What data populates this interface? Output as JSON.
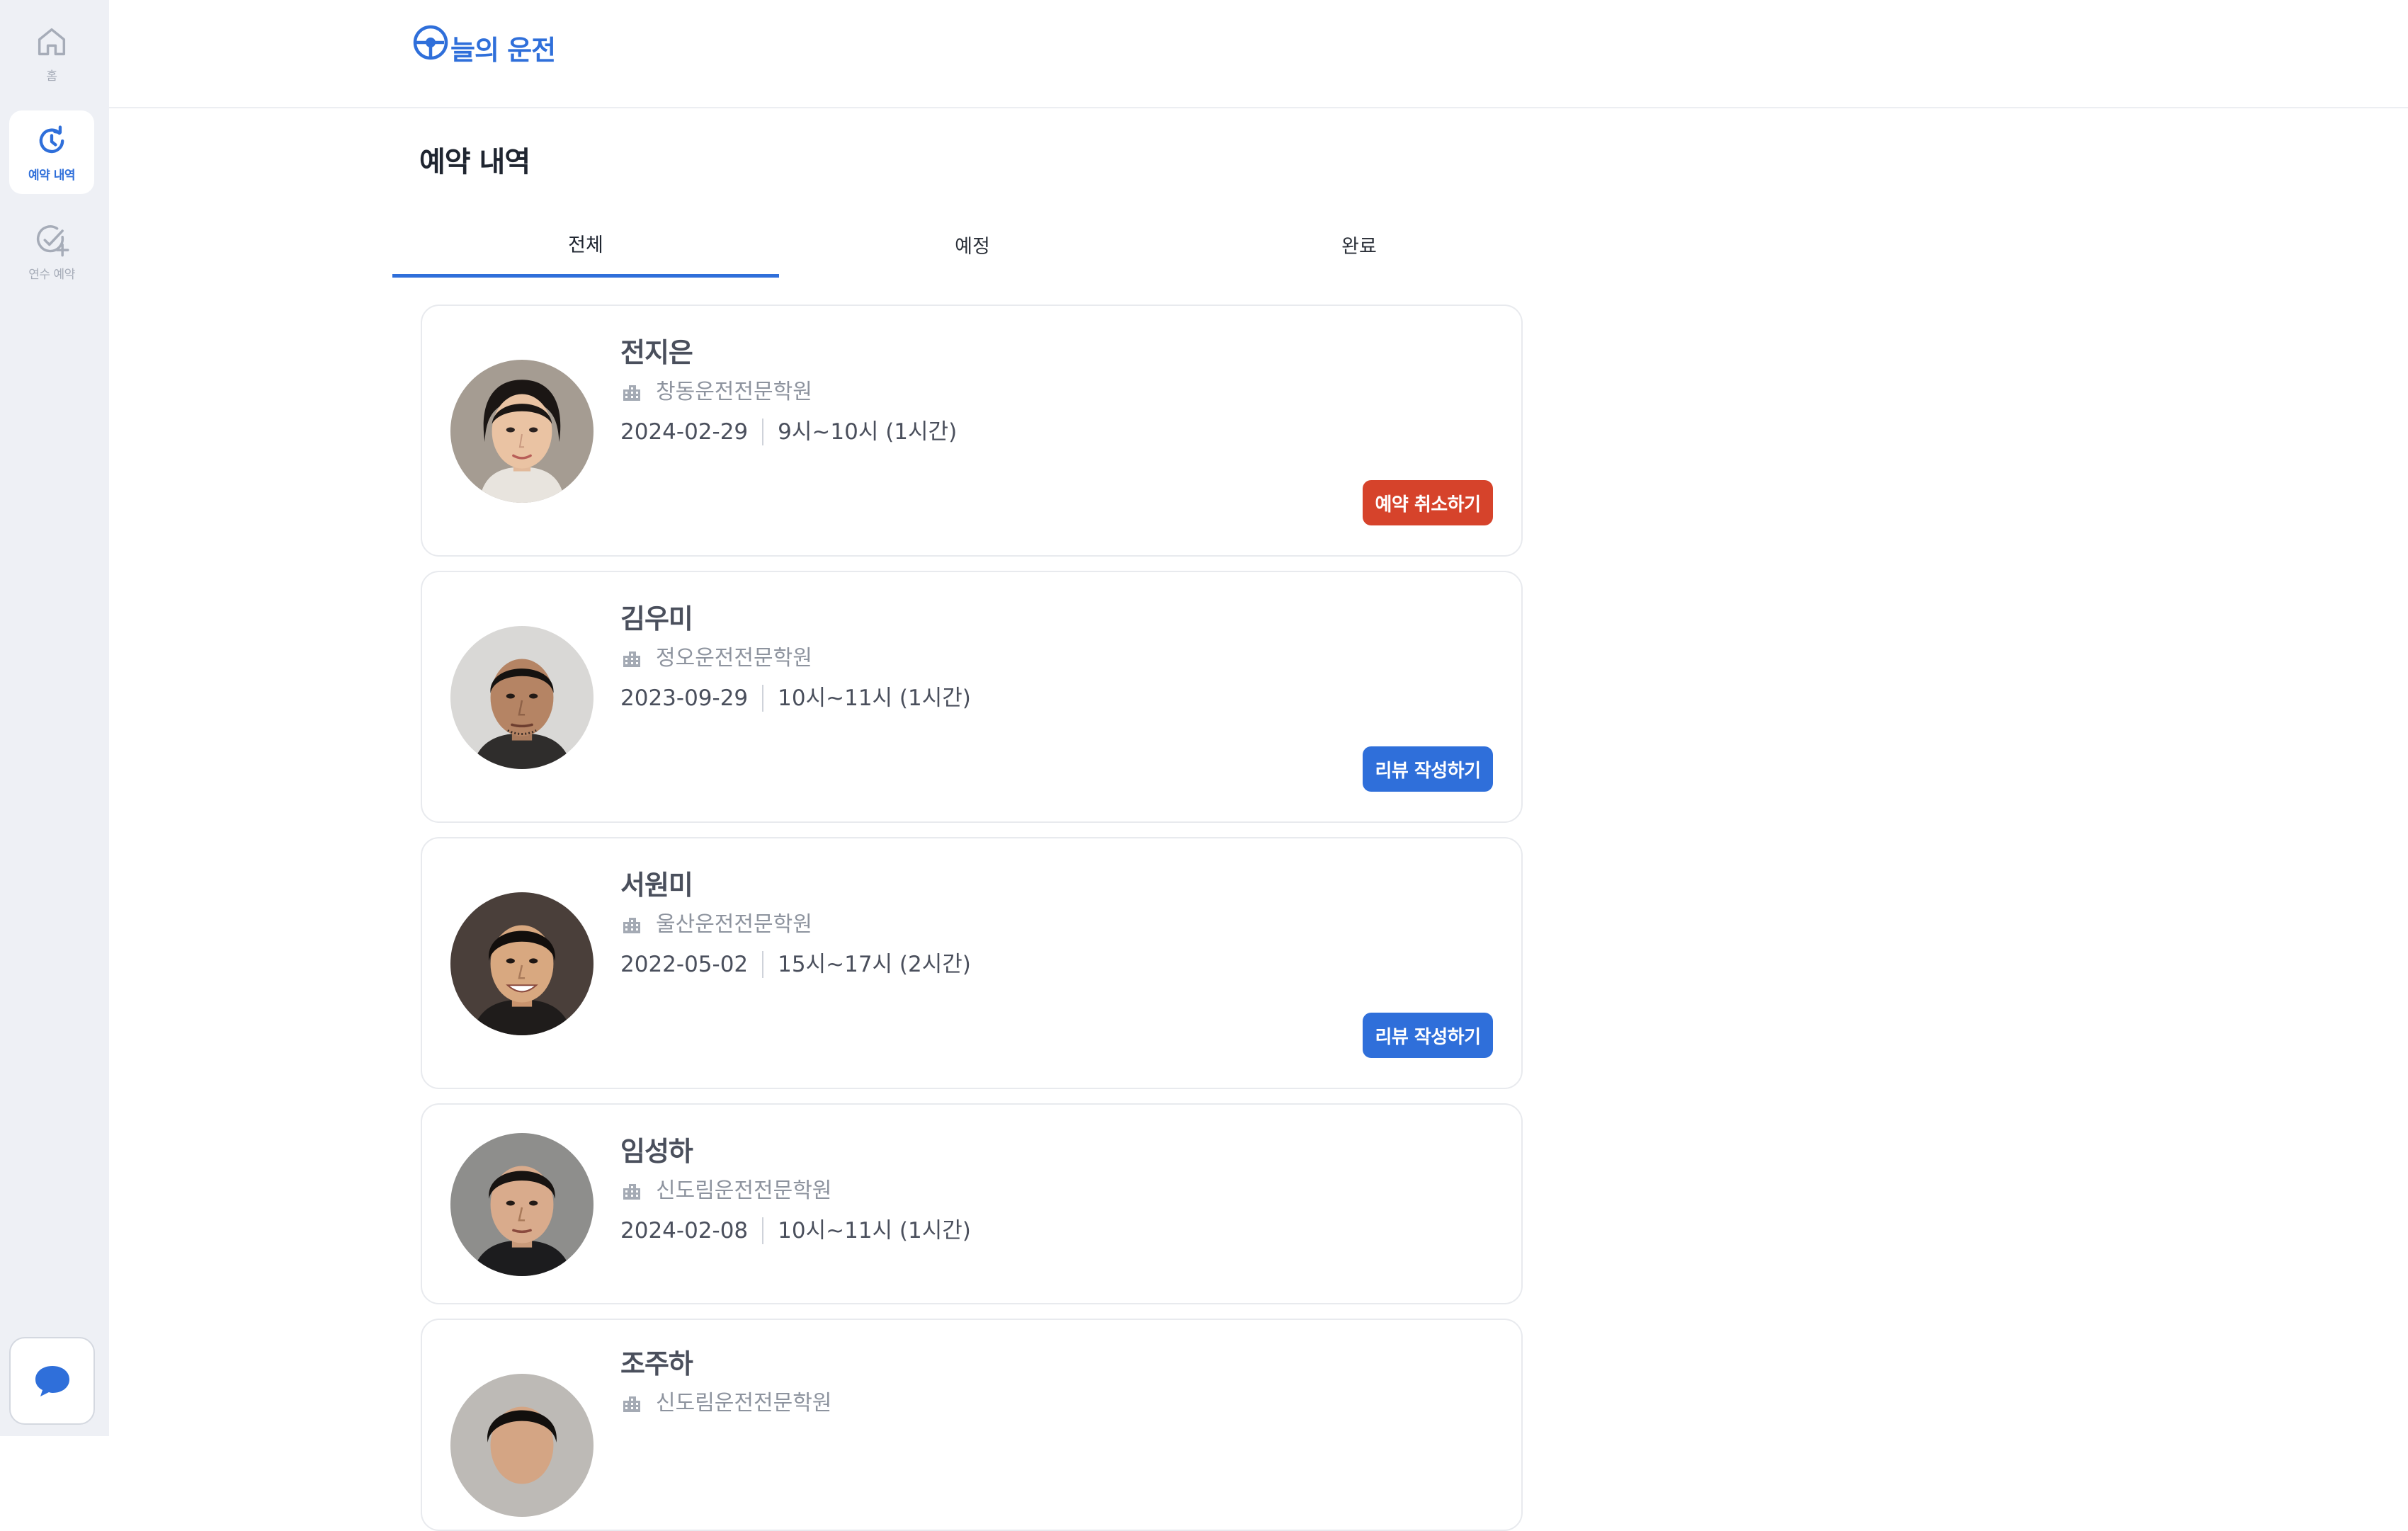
{
  "rail": {
    "items": [
      {
        "label": "홈",
        "icon": "home-icon",
        "active": false
      },
      {
        "label": "예약 내역",
        "icon": "history-icon",
        "active": true
      },
      {
        "label": "연수 예약",
        "icon": "check-plus-icon",
        "active": false
      }
    ],
    "chat_icon": "chat-bubble-icon"
  },
  "header": {
    "logo_text": "늘의 운전",
    "logo_icon": "steering-wheel-icon"
  },
  "page": {
    "title": "예약 내역"
  },
  "tabs": [
    {
      "label": "전체",
      "active": true
    },
    {
      "label": "예정",
      "active": false
    },
    {
      "label": "완료",
      "active": false
    }
  ],
  "colors": {
    "accent": "#2f6fda",
    "cancel": "#d6432b",
    "rail_bg": "#eef0f5"
  },
  "reservations": [
    {
      "name": "전지은",
      "school": "창동운전전문학원",
      "date": "2024-02-29",
      "time": "9시~10시 (1시간)",
      "action": "예약 취소하기",
      "action_type": "cancel"
    },
    {
      "name": "김우미",
      "school": "정오운전전문학원",
      "date": "2023-09-29",
      "time": "10시~11시 (1시간)",
      "action": "리뷰 작성하기",
      "action_type": "review"
    },
    {
      "name": "서원미",
      "school": "울산운전전문학원",
      "date": "2022-05-02",
      "time": "15시~17시 (2시간)",
      "action": "리뷰 작성하기",
      "action_type": "review"
    },
    {
      "name": "임성하",
      "school": "신도림운전전문학원",
      "date": "2024-02-08",
      "time": "10시~11시 (1시간)",
      "action": null,
      "action_type": null
    },
    {
      "name": "조주하",
      "school": "신도림운전전문학원",
      "date": "",
      "time": "",
      "action": null,
      "action_type": null
    }
  ]
}
